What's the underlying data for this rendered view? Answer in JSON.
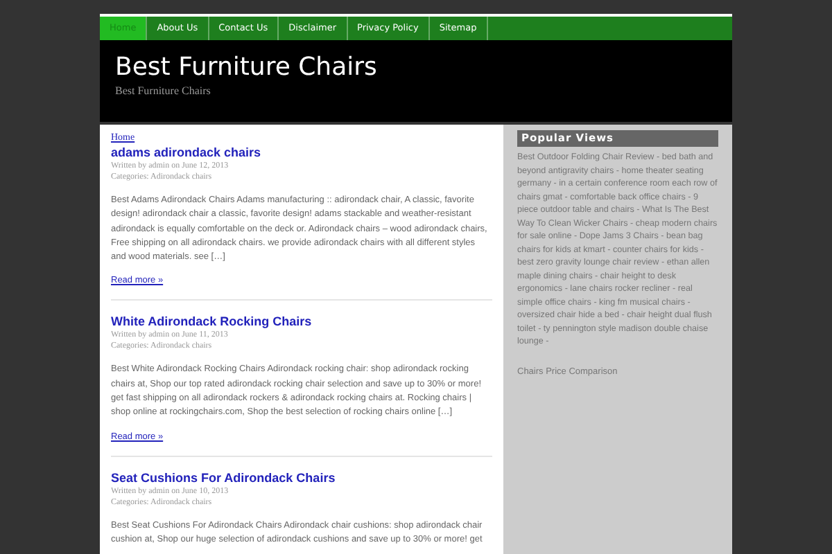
{
  "nav": [
    {
      "label": "Home",
      "selected": true
    },
    {
      "label": "About Us",
      "selected": false
    },
    {
      "label": "Contact Us",
      "selected": false
    },
    {
      "label": "Disclaimer",
      "selected": false
    },
    {
      "label": "Privacy Policy",
      "selected": false
    },
    {
      "label": "Sitemap",
      "selected": false
    }
  ],
  "header": {
    "title": "Best Furniture Chairs",
    "tagline": "Best Furniture Chairs"
  },
  "breadcrumb": "Home",
  "posts": [
    {
      "title": "adams adirondack chairs",
      "meta": "Written by admin on June 12, 2013",
      "categories": "Categories: Adirondack chairs",
      "excerpt": "Best Adams Adirondack Chairs Adams manufacturing :: adirondack chair, A classic, favorite design! adirondack chair a classic, favorite design! adams stackable and weather-resistant adirondack is equally comfortable on the deck or. Adirondack chairs – wood adirondack chairs, Free shipping on all adirondack chairs. we provide adirondack chairs with all different styles and wood materials. see […]",
      "read_more": "Read more »"
    },
    {
      "title": "White Adirondack Rocking Chairs",
      "meta": "Written by admin on June 11, 2013",
      "categories": "Categories: Adirondack chairs",
      "excerpt": "Best White Adirondack Rocking Chairs Adirondack rocking chair: shop adirondack rocking chairs at, Shop our top rated adirondack rocking chair selection and save up to 30% or more! get fast shipping on all adirondack rockers & adirondack rocking chairs at. Rocking chairs | shop online at rockingchairs.com, Shop the best selection of rocking chairs online […]",
      "read_more": "Read more »"
    },
    {
      "title": "Seat Cushions For Adirondack Chairs",
      "meta": "Written by admin on June 10, 2013",
      "categories": "Categories: Adirondack chairs",
      "excerpt": "Best Seat Cushions For Adirondack Chairs Adirondack chair cushions: shop adirondack chair cushion at, Shop our huge selection of adirondack cushions and save up to 30% or more! get"
    }
  ],
  "sidebar": {
    "heading": "Popular Views",
    "separator": "-",
    "links": [
      "Best Outdoor Folding Chair Review",
      "bed bath and beyond antigravity chairs",
      "home theater seating germany",
      "in a certain conference room each row of chairs gmat",
      "comfortable back office chairs",
      "9 piece outdoor table and chairs",
      "What Is The Best Way To Clean Wicker Chairs",
      "cheap modern chairs for sale online",
      "Dope Jams 3 Chairs",
      "bean bag chairs for kids at kmart",
      "counter chairs for kids",
      "best zero gravity lounge chair review",
      "ethan allen maple dining chairs",
      "chair height to desk ergonomics",
      "lane chairs rocker recliner",
      "real simple office chairs",
      "king fm musical chairs",
      "oversized chair hide a bed",
      "chair height dual flush toilet",
      "ty pennington style madison double chaise lounge"
    ],
    "footer_link": "Chairs Price Comparison"
  }
}
